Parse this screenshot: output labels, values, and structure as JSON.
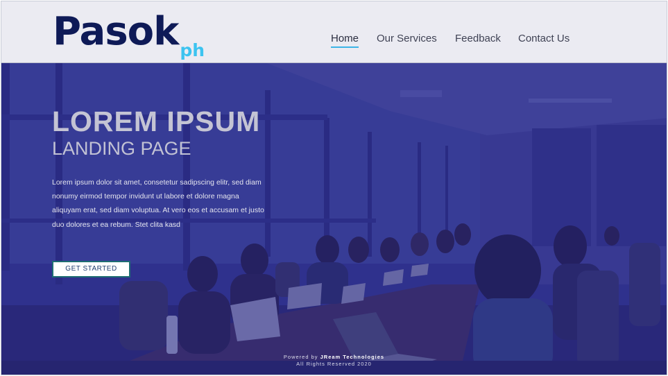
{
  "brand": {
    "name_main": "Pasok",
    "name_suffix": "ph",
    "colors": {
      "navy": "#0e1a57",
      "accent": "#3cc3f0",
      "overlay": "#262687"
    }
  },
  "nav": {
    "items": [
      {
        "label": "Home",
        "active": true
      },
      {
        "label": "Our Services",
        "active": false
      },
      {
        "label": "Feedback",
        "active": false
      },
      {
        "label": "Contact Us",
        "active": false
      }
    ]
  },
  "hero": {
    "title": "LOREM IPSUM",
    "subtitle": "LANDING PAGE",
    "body": "Lorem ipsum dolor sit amet, consetetur sadipscing elitr, sed diam nonumy eirmod tempor invidunt ut labore et dolore magna aliquyam erat, sed diam voluptua. At vero eos et accusam et justo duo dolores et ea rebum. Stet clita kasd",
    "cta_label": "GET STARTED",
    "background": "conference-room-photo"
  },
  "footer": {
    "powered_prefix": "Powered by",
    "powered_company": "JReam Technologies",
    "rights": "All Rights Reserved 2020"
  }
}
